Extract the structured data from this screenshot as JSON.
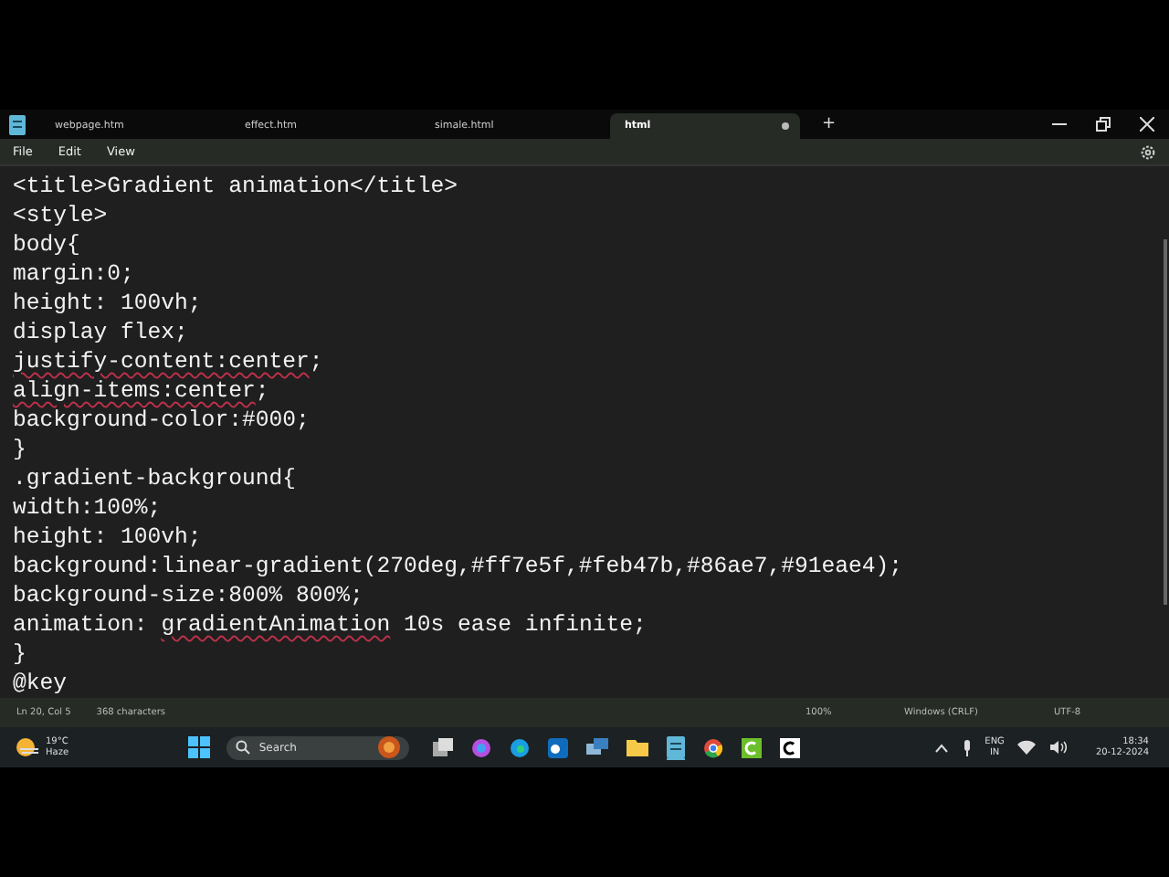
{
  "tabs": [
    {
      "label": "webpage.htm",
      "selected": false,
      "unsaved": false
    },
    {
      "label": "effect.htm",
      "selected": false,
      "unsaved": false
    },
    {
      "label": "simale.html",
      "selected": false,
      "unsaved": false
    },
    {
      "label": "html",
      "selected": true,
      "unsaved": true
    }
  ],
  "new_tab": "+",
  "menu": [
    "File",
    "Edit",
    "View"
  ],
  "editor": {
    "lines": [
      [
        {
          "text": "<title>Gradient animation</title>",
          "misspelled": false
        }
      ],
      [
        {
          "text": "<style>",
          "misspelled": false
        }
      ],
      [
        {
          "text": "body{",
          "misspelled": false
        }
      ],
      [
        {
          "text": "margin:0;",
          "misspelled": false
        }
      ],
      [
        {
          "text": "height: 100vh;",
          "misspelled": false
        }
      ],
      [
        {
          "text": "display flex;",
          "misspelled": false
        }
      ],
      [
        {
          "text": "justify-content:center",
          "misspelled": true
        },
        {
          "text": ";",
          "misspelled": false
        }
      ],
      [
        {
          "text": "align-items:center",
          "misspelled": true
        },
        {
          "text": ";",
          "misspelled": false
        }
      ],
      [
        {
          "text": "background-color:#000;",
          "misspelled": false
        }
      ],
      [
        {
          "text": "}",
          "misspelled": false
        }
      ],
      [
        {
          "text": ".gradient-background{",
          "misspelled": false
        }
      ],
      [
        {
          "text": "width:100%;",
          "misspelled": false
        }
      ],
      [
        {
          "text": "height: 100vh;",
          "misspelled": false
        }
      ],
      [
        {
          "text": "background:linear-gradient(270deg,#ff7e5f,#feb47b,#86ae7,#91eae4);",
          "misspelled": false
        }
      ],
      [
        {
          "text": "background-size:800% 800%;",
          "misspelled": false
        }
      ],
      [
        {
          "text": "animation: ",
          "misspelled": false
        },
        {
          "text": "gradientAnimation",
          "misspelled": true
        },
        {
          "text": " 10s ease infinite;",
          "misspelled": false
        }
      ],
      [
        {
          "text": "}",
          "misspelled": false
        }
      ],
      [
        {
          "text": "@key",
          "misspelled": false
        }
      ]
    ]
  },
  "status_bar": {
    "position": "Ln 20, Col 5",
    "characters": "368 characters",
    "zoom": "100%",
    "line_ending": "Windows (CRLF)",
    "encoding": "UTF-8"
  },
  "taskbar": {
    "weather_temp": "19°C",
    "weather_text": "Haze",
    "search_placeholder": "Search",
    "language": "ENG",
    "region": "IN",
    "time": "18:34",
    "date": "20-12-2024"
  }
}
